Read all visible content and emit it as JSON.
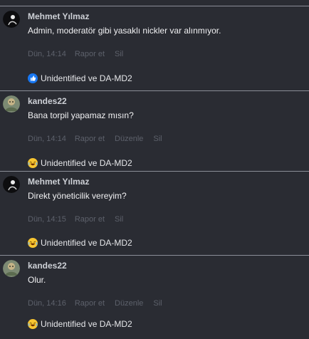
{
  "messages": [
    {
      "author": "Mehmet Yılmaz",
      "avatar": "dark-avatar",
      "text": "Admin, moderatör gibi yasaklı nickler var alınmıyor.",
      "time": "Dün, 14:14",
      "actions": [
        "Rapor et",
        "Sil"
      ],
      "reaction_icon": "like-icon",
      "reactors": "Unidentified ve DA-MD2"
    },
    {
      "author": "kandes22",
      "avatar": "character-avatar",
      "text": "Bana torpil yapamaz mısın?",
      "time": "Dün, 14:14",
      "actions": [
        "Rapor et",
        "Düzenle",
        "Sil"
      ],
      "reaction_icon": "laugh-icon",
      "reactors": "Unidentified ve DA-MD2"
    },
    {
      "author": "Mehmet Yılmaz",
      "avatar": "dark-avatar",
      "text": "Direkt yöneticilik vereyim?",
      "time": "Dün, 14:15",
      "actions": [
        "Rapor et",
        "Sil"
      ],
      "reaction_icon": "laugh-icon",
      "reactors": "Unidentified ve DA-MD2"
    },
    {
      "author": "kandes22",
      "avatar": "character-avatar",
      "text": "Olur.",
      "time": "Dün, 14:16",
      "actions": [
        "Rapor et",
        "Düzenle",
        "Sil"
      ],
      "reaction_icon": "laugh-icon",
      "reactors": "Unidentified ve DA-MD2"
    }
  ],
  "colors": {
    "background": "#2a2c33",
    "divider": "#8b8e98",
    "muted_action": "#5d616b",
    "like_blue": "#1877f2",
    "laugh_yellow": "#f7c531"
  }
}
